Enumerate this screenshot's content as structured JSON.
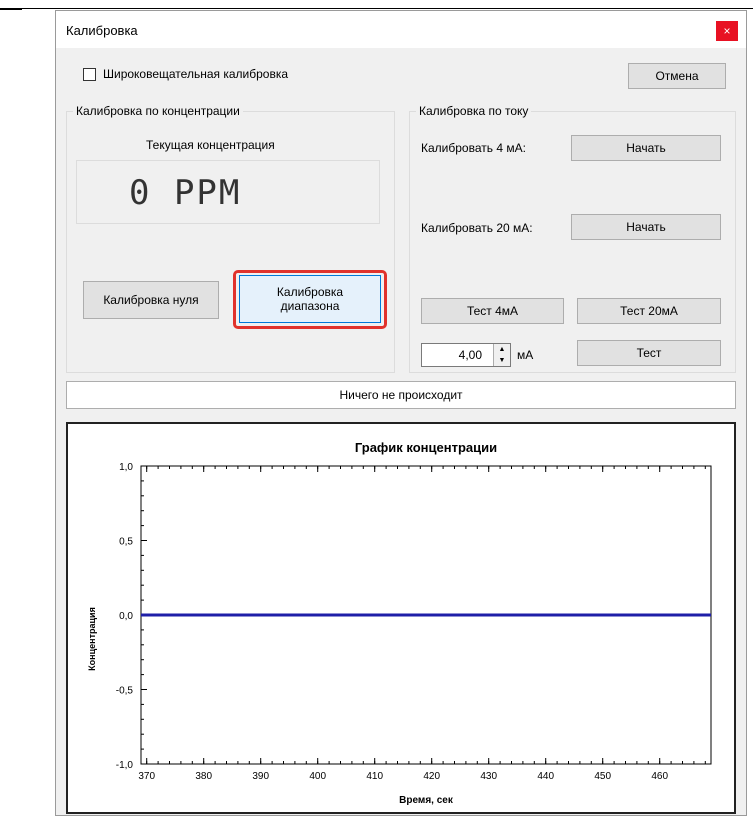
{
  "window": {
    "title": "Калибровка",
    "close_label": "×"
  },
  "broadcast": {
    "label": "Широковещательная калибровка",
    "checked": false
  },
  "cancel_label": "Отмена",
  "concentration": {
    "group_title": "Калибровка по концентрации",
    "current_label": "Текущая концентрация",
    "value_display": "0 PPM",
    "zero_button": "Калибровка нуля",
    "range_button": "Калибровка диапазона"
  },
  "current": {
    "group_title": "Калибровка по току",
    "cal4_label": "Калибровать 4 мА:",
    "cal4_button": "Начать",
    "cal20_label": "Калибровать 20 мА:",
    "cal20_button": "Начать",
    "test4_button": "Тест 4мА",
    "test20_button": "Тест 20мА",
    "spin_value": "4,00",
    "unit_label": "мА",
    "test_button": "Тест"
  },
  "status_text": "Ничего не происходит",
  "chart_data": {
    "type": "line",
    "title": "График концентрации",
    "xlabel": "Время, сек",
    "ylabel": "Концентрация",
    "xlim": [
      369,
      469
    ],
    "ylim": [
      -1.0,
      1.0
    ],
    "x_ticks": [
      370,
      380,
      390,
      400,
      410,
      420,
      430,
      440,
      450,
      460
    ],
    "y_ticks": [
      1.0,
      0.5,
      0.0,
      -0.5,
      -1.0
    ],
    "y_tick_labels": [
      "1,0",
      "0,5",
      "0,0",
      "-0,5",
      "-1,0"
    ],
    "series": [
      {
        "color": "#1f1fa8",
        "x_start": 369,
        "x_end": 469,
        "y": 0.0
      }
    ]
  }
}
